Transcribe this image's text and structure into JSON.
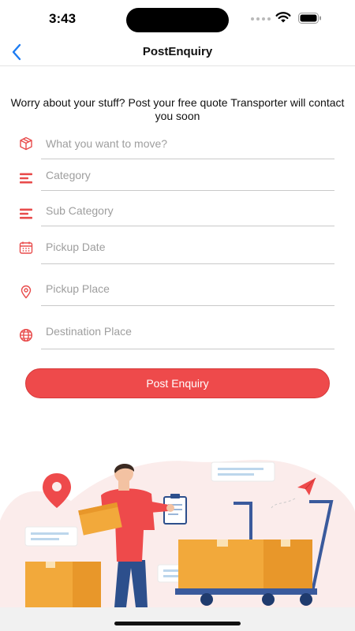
{
  "status_bar": {
    "time": "3:43"
  },
  "nav": {
    "title": "PostEnquiry"
  },
  "intro": {
    "text": "Worry about your stuff? Post your free quote Transporter will contact you soon"
  },
  "form": {
    "fields": [
      {
        "icon": "box-icon",
        "placeholder": "What you want to move?",
        "value": ""
      },
      {
        "icon": "menu-lines-icon",
        "placeholder": "Category",
        "value": ""
      },
      {
        "icon": "menu-lines-icon",
        "placeholder": "Sub Category",
        "value": ""
      },
      {
        "icon": "calendar-icon",
        "placeholder": "Pickup Date",
        "value": ""
      },
      {
        "icon": "location-pin-icon",
        "placeholder": "Pickup Place",
        "value": ""
      },
      {
        "icon": "globe-icon",
        "placeholder": "Destination Place",
        "value": ""
      }
    ],
    "submit_label": "Post Enquiry"
  },
  "colors": {
    "accent": "#ee4a4b",
    "icon": "#e84b4b",
    "box": "#f2a93b",
    "shirt": "#ee4a4b",
    "pants": "#2d4f8c"
  },
  "illustration": {
    "name": "moving-delivery-illustration"
  }
}
